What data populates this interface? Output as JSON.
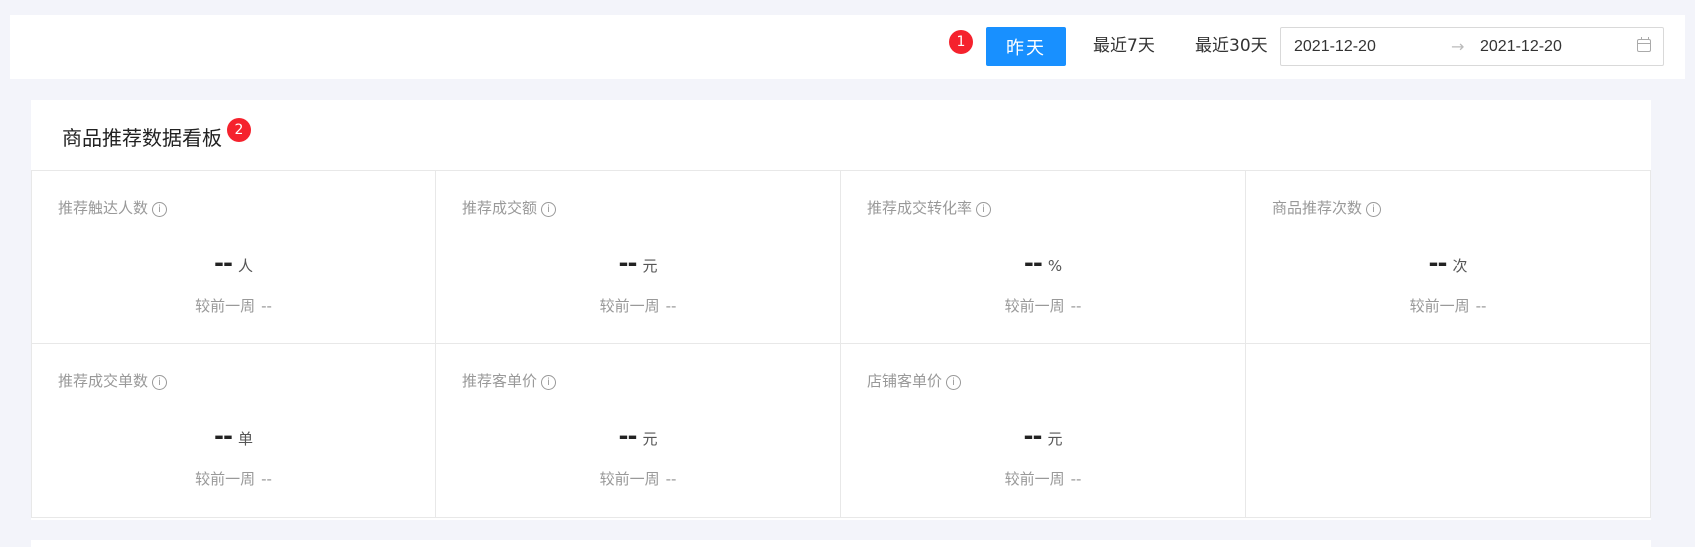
{
  "toolbar": {
    "badge": "1",
    "yesterday_label": "昨天",
    "last7_label": "最近7天",
    "last30_label": "最近30天",
    "date_start": "2021-12-20",
    "date_end": "2021-12-20",
    "range_arrow": "→",
    "active_color": "#1890ff"
  },
  "panel": {
    "title": "商品推荐数据看板",
    "badge": "2",
    "metrics": [
      {
        "label": "推荐触达人数",
        "value": "--",
        "unit": "人",
        "compare_label": "较前一周",
        "compare_value": "--"
      },
      {
        "label": "推荐成交额",
        "value": "--",
        "unit": "元",
        "compare_label": "较前一周",
        "compare_value": "--"
      },
      {
        "label": "推荐成交转化率",
        "value": "--",
        "unit": "%",
        "compare_label": "较前一周",
        "compare_value": "--"
      },
      {
        "label": "商品推荐次数",
        "value": "--",
        "unit": "次",
        "compare_label": "较前一周",
        "compare_value": "--"
      },
      {
        "label": "推荐成交单数",
        "value": "--",
        "unit": "单",
        "compare_label": "较前一周",
        "compare_value": "--"
      },
      {
        "label": "推荐客单价",
        "value": "--",
        "unit": "元",
        "compare_label": "较前一周",
        "compare_value": "--"
      },
      {
        "label": "店铺客单价",
        "value": "--",
        "unit": "元",
        "compare_label": "较前一周",
        "compare_value": "--"
      }
    ]
  },
  "icons": {
    "info": "info-circle-icon",
    "calendar": "calendar-icon"
  }
}
